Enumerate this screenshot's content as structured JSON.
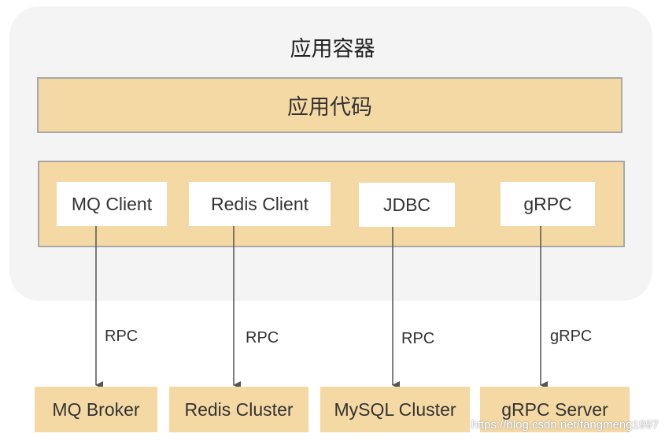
{
  "container": {
    "title": "应用容器"
  },
  "app_code": {
    "label": "应用代码"
  },
  "clients": [
    {
      "label": "MQ Client"
    },
    {
      "label": "Redis Client"
    },
    {
      "label": "JDBC"
    },
    {
      "label": "gRPC"
    }
  ],
  "edges": [
    {
      "label": "RPC"
    },
    {
      "label": "RPC"
    },
    {
      "label": "RPC"
    },
    {
      "label": "gRPC"
    }
  ],
  "targets": [
    {
      "label": "MQ Broker"
    },
    {
      "label": "Redis Cluster"
    },
    {
      "label": "MySQL Cluster"
    },
    {
      "label": "gRPC Server"
    }
  ],
  "watermark": "https://blog.csdn.net/fangmeng1997",
  "colors": {
    "container_bg": "#f4f4f4",
    "box_fill": "#f5d9a4",
    "box_border": "#a8a8a8",
    "arrow": "#555555"
  }
}
